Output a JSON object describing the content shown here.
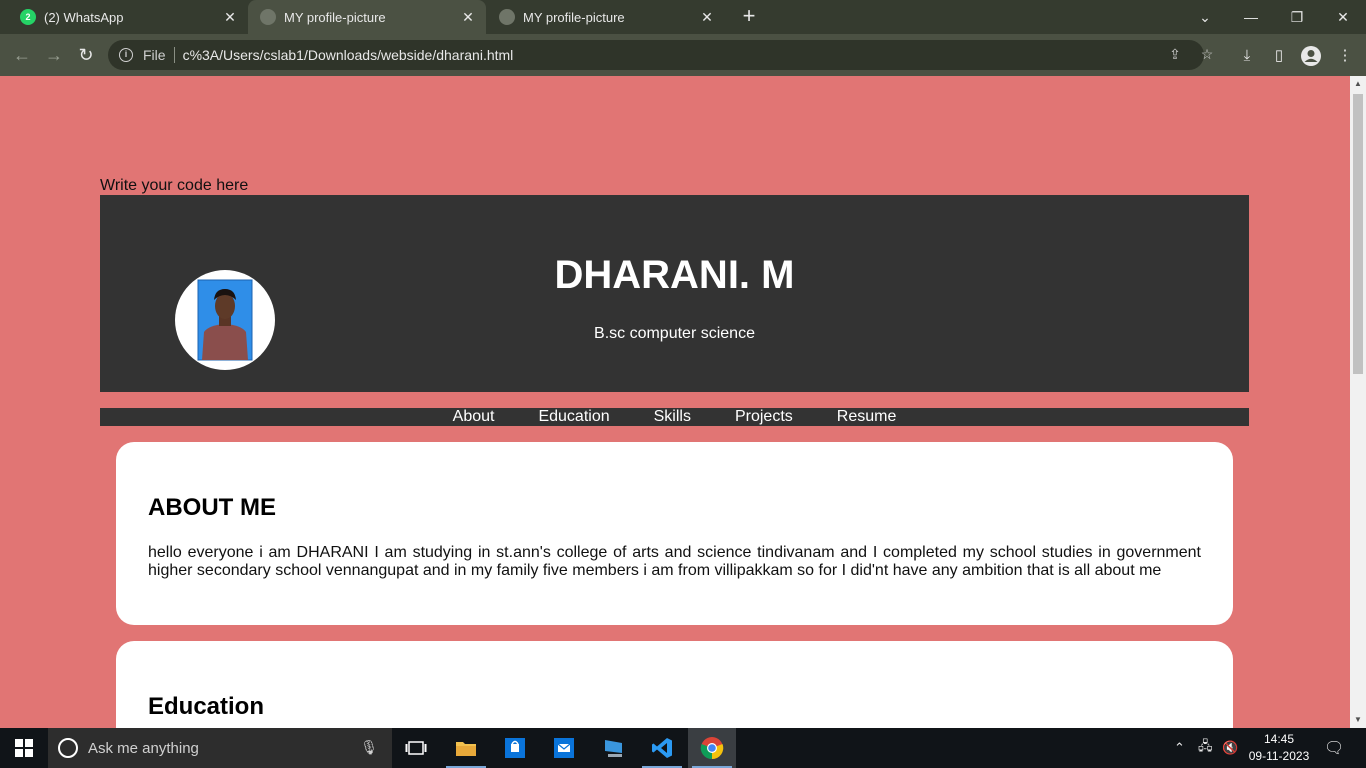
{
  "browser": {
    "tabs": [
      {
        "label": "(2) WhatsApp",
        "badge": "2"
      },
      {
        "label": "MY profile-picture"
      },
      {
        "label": "MY profile-picture"
      }
    ],
    "address": {
      "scheme_label": "File",
      "url": "c%3A/Users/cslab1/Downloads/webside/dharani.html"
    }
  },
  "page": {
    "placeholder_text": "Write your code here",
    "header": {
      "name": "DHARANI. M",
      "subtitle": "B.sc computer science"
    },
    "nav": [
      "About",
      "Education",
      "Skills",
      "Projects",
      "Resume"
    ],
    "about": {
      "heading": "ABOUT ME",
      "text": "hello everyone i am DHARANI I am studying in st.ann's college of arts and science tindivanam and I completed my school studies in government higher secondary school vennangupat and in my family five members i am from villipakkam so for I did'nt have any ambition that is all about me"
    },
    "education": {
      "heading": "Education"
    }
  },
  "taskbar": {
    "search_placeholder": "Ask me anything",
    "time": "14:45",
    "date": "09-11-2023"
  },
  "colors": {
    "page_background": "#e17574",
    "header_background": "#333333",
    "tabbar_background": "#353b2f",
    "toolbar_background": "#4b5143"
  },
  "icons": {
    "whatsapp": "whatsapp-icon",
    "globe": "globe-icon",
    "close": "close-icon",
    "new_tab": "plus-icon",
    "back": "arrow-left-icon",
    "forward": "arrow-right-icon",
    "reload": "reload-icon",
    "info": "info-icon",
    "share": "share-icon",
    "star": "star-icon",
    "download": "download-icon",
    "side_panel": "side-panel-icon",
    "profile": "profile-icon",
    "menu": "kebab-menu-icon"
  }
}
